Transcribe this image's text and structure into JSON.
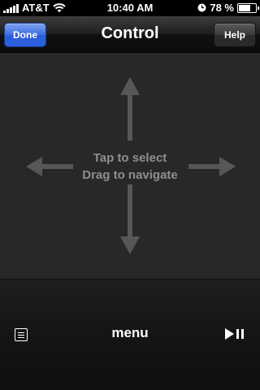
{
  "status_bar": {
    "carrier": "AT&T",
    "time": "10:40 AM",
    "battery_percent": "78 %",
    "battery_level": 0.78,
    "icons": [
      "signal-bars-icon",
      "wifi-icon",
      "alarm-clock-icon",
      "battery-icon"
    ]
  },
  "nav": {
    "title": "Control",
    "left_button": "Done",
    "right_button": "Help",
    "colors": {
      "done_button": "#2b5fe0",
      "help_button": "#3a3a3a"
    }
  },
  "touchpad": {
    "hint_line1": "Tap to select",
    "hint_line2": "Drag to navigate",
    "arrow_icon": "four-direction-arrows-icon",
    "colors": {
      "background": "#282828",
      "arrow": "#555555",
      "hint_text": "#8e8e8e"
    }
  },
  "toolbar": {
    "menu_label": "menu",
    "left_icon": "list-icon",
    "right_icon": "play-pause-icon"
  }
}
